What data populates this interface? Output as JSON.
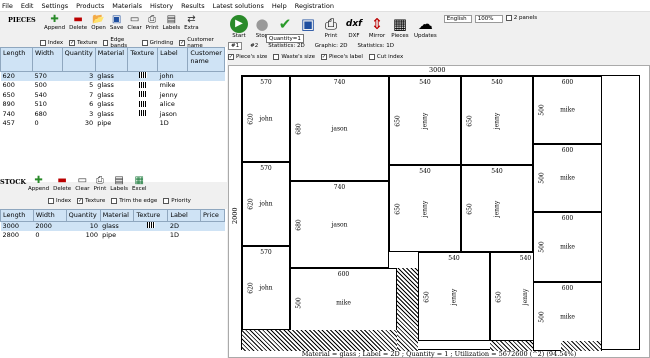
{
  "menu": [
    "File",
    "Edit",
    "Settings",
    "Products",
    "Materials",
    "History",
    "Results",
    "Latest solutions",
    "Help",
    "Registration"
  ],
  "pieces": {
    "title": "PIECES",
    "toolbar": [
      "Append",
      "Delete",
      "Open",
      "Save",
      "Clear",
      "Print",
      "Labels",
      "Extra"
    ],
    "options": [
      {
        "label": "Index",
        "checked": false
      },
      {
        "label": "Texture",
        "checked": true
      },
      {
        "label": "Edge bands",
        "checked": false
      },
      {
        "label": "Grinding",
        "checked": false
      },
      {
        "label": "Customer name",
        "checked": true
      }
    ],
    "columns": [
      "Length",
      "Width",
      "Quantity",
      "Material",
      "Texture",
      "Label",
      "Customer name"
    ],
    "rows": [
      {
        "length": "620",
        "width": "570",
        "quantity": "3",
        "material": "glass",
        "texture": true,
        "label": "john",
        "selected": true
      },
      {
        "length": "600",
        "width": "500",
        "quantity": "5",
        "material": "glass",
        "texture": true,
        "label": "mike",
        "selected": false
      },
      {
        "length": "650",
        "width": "540",
        "quantity": "7",
        "material": "glass",
        "texture": true,
        "label": "jenny",
        "selected": false
      },
      {
        "length": "890",
        "width": "510",
        "quantity": "6",
        "material": "glass",
        "texture": true,
        "label": "alice",
        "selected": false
      },
      {
        "length": "740",
        "width": "680",
        "quantity": "3",
        "material": "glass",
        "texture": true,
        "label": "jason",
        "selected": false
      },
      {
        "length": "457",
        "width": "0",
        "quantity": "30",
        "material": "pipe",
        "texture": false,
        "label": "1D",
        "selected": false
      }
    ]
  },
  "stock": {
    "title": "STOCK",
    "toolbar": [
      "Append",
      "Delete",
      "Clear",
      "Print",
      "Labels",
      "Excel"
    ],
    "options": [
      {
        "label": "Index",
        "checked": false
      },
      {
        "label": "Texture",
        "checked": true
      },
      {
        "label": "Trim the edge",
        "checked": false
      },
      {
        "label": "Priority",
        "checked": false
      }
    ],
    "columns": [
      "Length",
      "Width",
      "Quantity",
      "Material",
      "Texture",
      "Label",
      "Price"
    ],
    "rows": [
      {
        "length": "3000",
        "width": "2000",
        "quantity": "10",
        "material": "glass",
        "texture": true,
        "label": "2D",
        "selected": true
      },
      {
        "length": "2800",
        "width": "0",
        "quantity": "100",
        "material": "pipe",
        "texture": false,
        "label": "1D",
        "selected": false
      }
    ]
  },
  "right_toolbar": {
    "buttons": [
      "Start",
      "Stop",
      "",
      "",
      "Print",
      "DXF",
      "Mirror",
      "Pieces",
      "Updates"
    ],
    "language": "English",
    "zoom": "100%",
    "two_panels": "2 panels",
    "tooltip": "Quantity=1",
    "sheet_tabs": [
      "#1",
      "#2"
    ],
    "stats": [
      "Statistics: 2D",
      "Graphic: 2D",
      "Statistics: 1D"
    ]
  },
  "view_options": [
    {
      "label": "Piece's size",
      "checked": true
    },
    {
      "label": "Waste's size",
      "checked": false
    },
    {
      "label": "Piece's label",
      "checked": true
    },
    {
      "label": "Cut index",
      "checked": false
    }
  ],
  "layout": {
    "sheet_width": "3000",
    "sheet_height": "2000",
    "status": "Material = glass ; Label = 2D ; Quantity = 1 ; Utilization = 5672600 (^2) (94.54%)",
    "pieces": [
      {
        "w": "570",
        "h": "620",
        "label": "john"
      },
      {
        "w": "740",
        "h": "680",
        "label": "jason"
      },
      {
        "w": "540",
        "h": "650",
        "label": "jenny"
      },
      {
        "w": "540",
        "h": "650",
        "label": "jenny"
      },
      {
        "w": "600",
        "h": "500",
        "label": "mike"
      },
      {
        "w": "570",
        "h": "620",
        "label": "john"
      },
      {
        "w": "740",
        "h": "680",
        "label": "jason"
      },
      {
        "w": "540",
        "h": "650",
        "label": "jenny"
      },
      {
        "w": "540",
        "h": "650",
        "label": "jenny"
      },
      {
        "w": "600",
        "h": "500",
        "label": "mike"
      },
      {
        "w": "570",
        "h": "620",
        "label": "john"
      },
      {
        "w": "600",
        "h": "500",
        "label": "mike"
      },
      {
        "w": "540",
        "h": "650",
        "label": "jenny"
      },
      {
        "w": "540",
        "h": "650",
        "label": "jenny"
      },
      {
        "w": "600",
        "h": "500",
        "label": "mike"
      },
      {
        "w": "600",
        "h": "500",
        "label": "mike"
      }
    ]
  }
}
